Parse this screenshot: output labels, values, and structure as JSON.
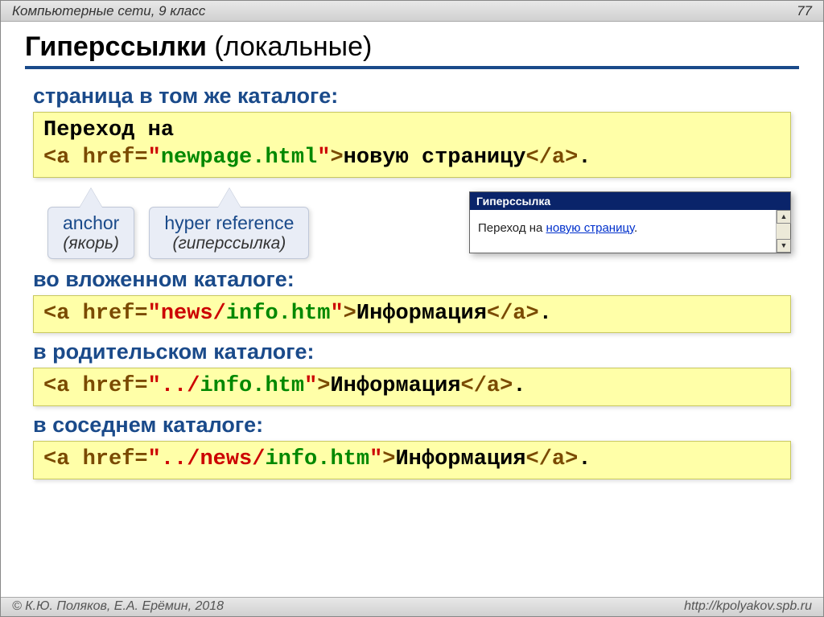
{
  "header": {
    "course": "Компьютерные сети, 9 класс",
    "page": "77"
  },
  "title": {
    "bold": "Гиперссылки",
    "rest": " (локальные)"
  },
  "sections": {
    "s1": "страница в том же каталоге:",
    "s2": "во вложенном каталоге:",
    "s3": "в родительском каталоге:",
    "s4": "в соседнем каталоге:"
  },
  "code1": {
    "l1": "Переход на",
    "open": "<a href=",
    "quote1": "\"",
    "file": "newpage.html",
    "quote2": "\"",
    "gt": ">",
    "text": "новую страницу",
    "close": "</a>",
    "dot": "."
  },
  "callouts": {
    "c1a": "anchor",
    "c1b": "(якорь)",
    "c2a": "hyper reference",
    "c2b": "(гиперссылка)"
  },
  "browser": {
    "title": "Гиперссылка",
    "pre": "Переход на ",
    "link": "новую страницу",
    "post": "."
  },
  "code2": {
    "open": "<a href=",
    "q1": "\"",
    "folder": "news/",
    "file": "info.htm",
    "q2": "\"",
    "gt": ">",
    "text": "Информация",
    "close": "</a>",
    "dot": "."
  },
  "code3": {
    "open": "<a href=",
    "q1": "\"",
    "dots": "../",
    "file": "info.htm",
    "q2": "\"",
    "gt": ">",
    "text": "Информация",
    "close": "</a>",
    "dot": "."
  },
  "code4": {
    "open": "<a href=",
    "q1": "\"",
    "dots": "../",
    "folder": "news/",
    "file": "info.htm",
    "q2": "\"",
    "gt": ">",
    "text": "Информация",
    "close": "</a>",
    "dot": "."
  },
  "footer": {
    "copy": "© К.Ю. Поляков, Е.А. Ерёмин, 2018",
    "url": "http://kpolyakov.spb.ru"
  }
}
